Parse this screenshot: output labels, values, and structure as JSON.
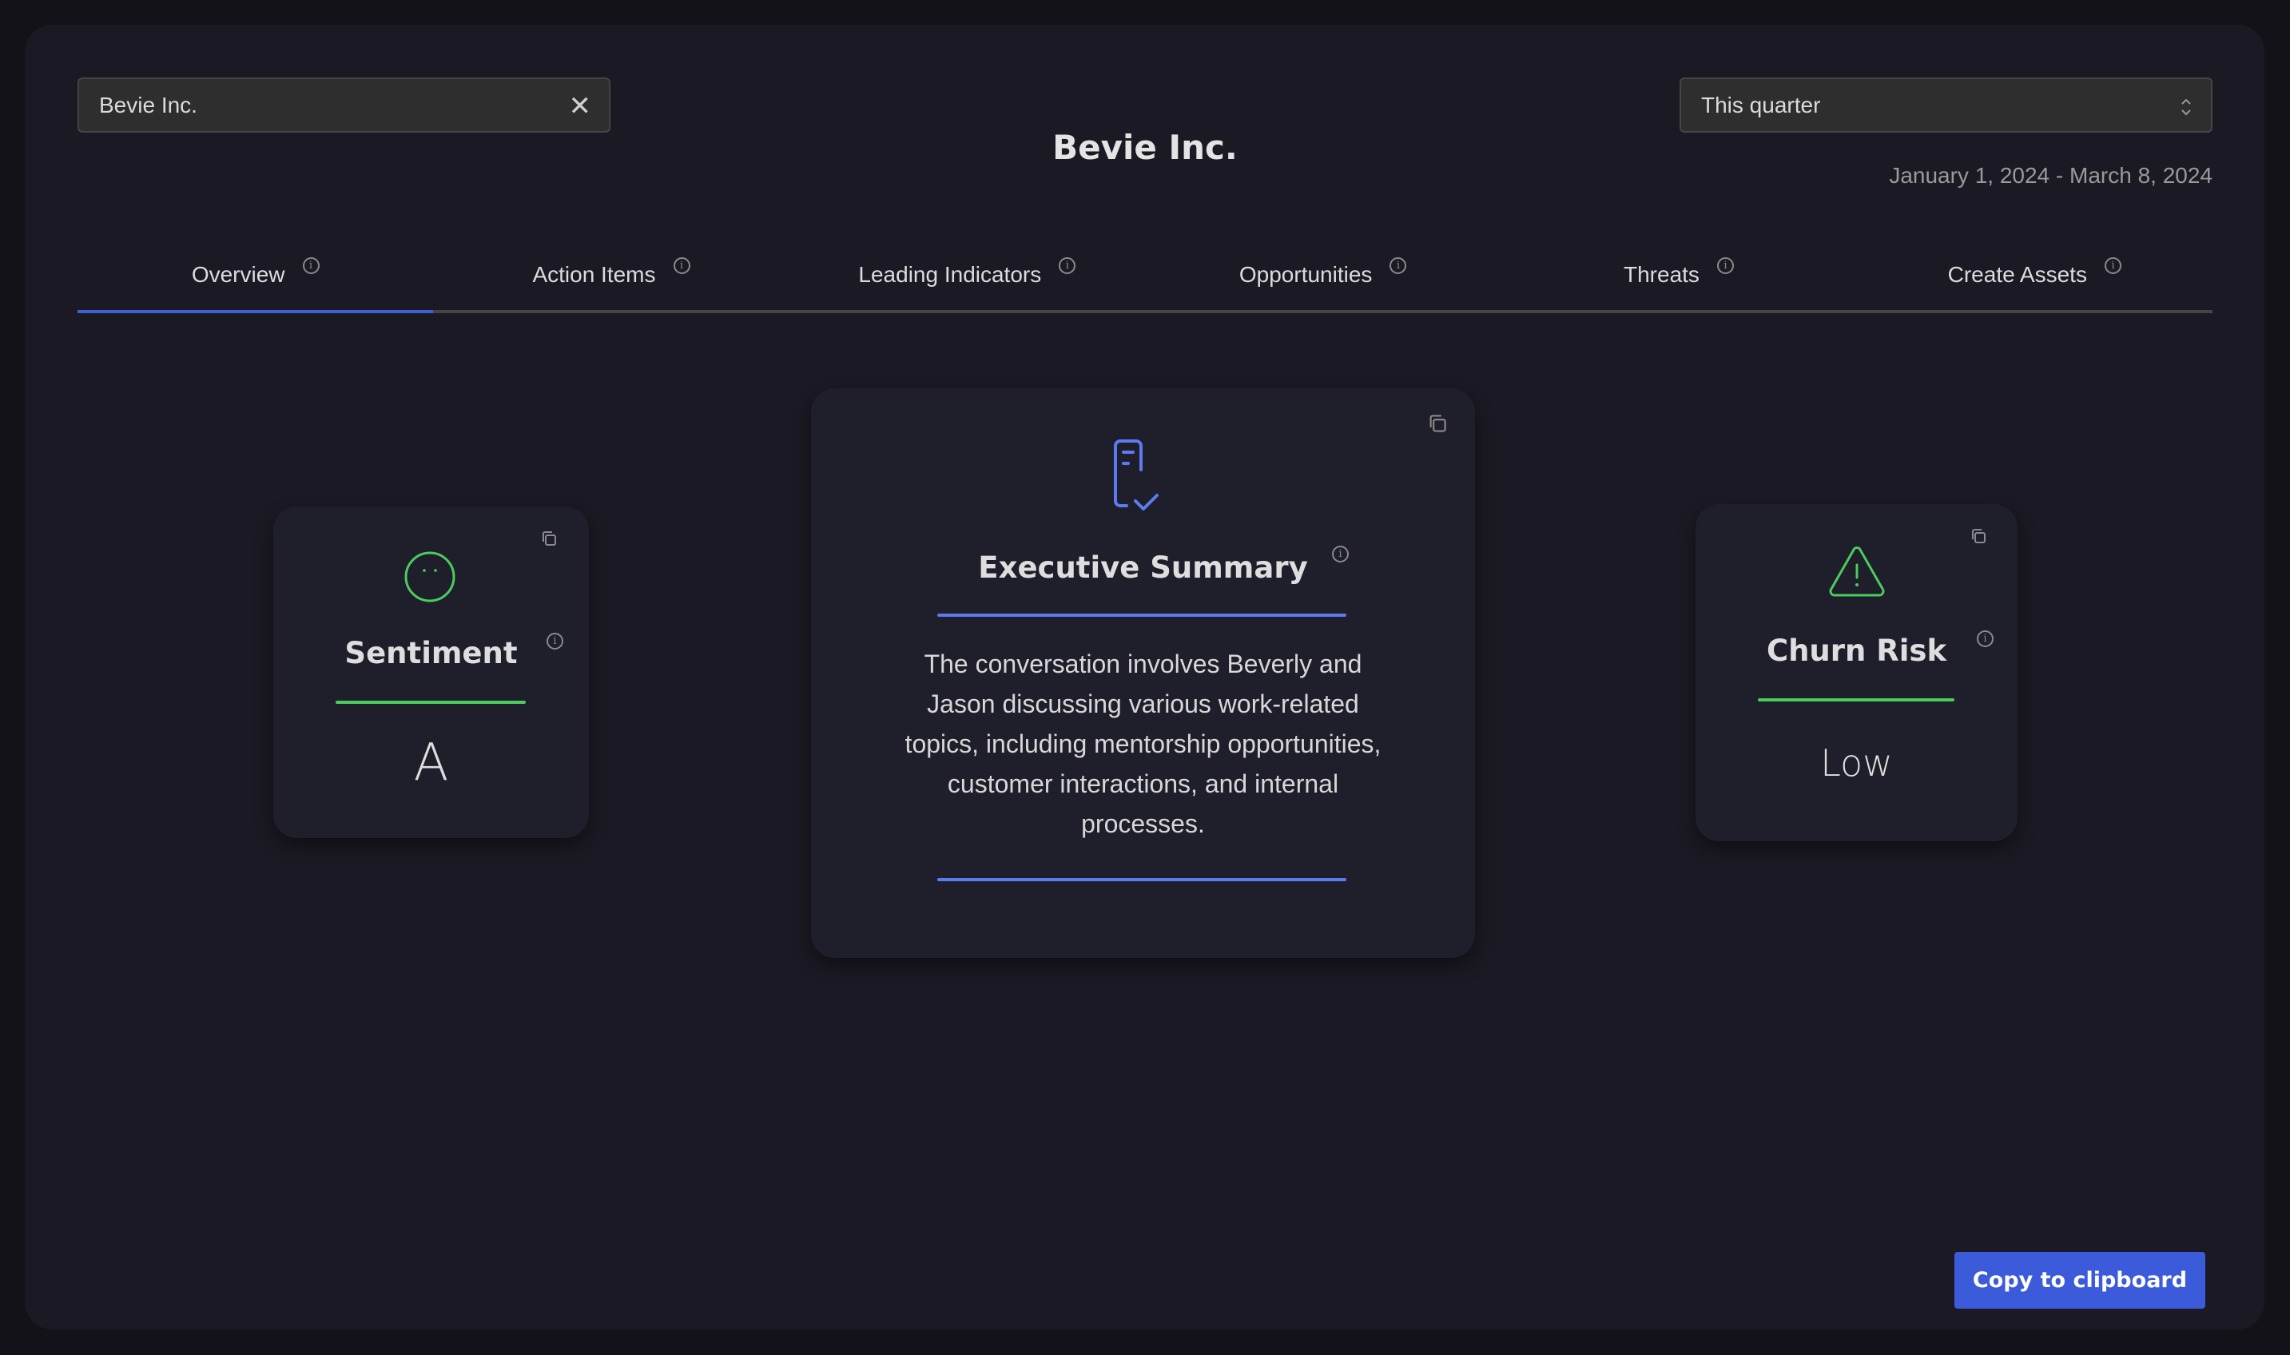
{
  "search": {
    "value": "Bevie Inc.",
    "clear_icon": "close-icon"
  },
  "header": {
    "title": "Bevie Inc."
  },
  "period": {
    "selected": "This quarter",
    "date_range": "January 1, 2024 - March 8, 2024"
  },
  "tabs": [
    {
      "label": "Overview",
      "active": true
    },
    {
      "label": "Action Items"
    },
    {
      "label": "Leading Indicators"
    },
    {
      "label": "Opportunities"
    },
    {
      "label": "Threats"
    },
    {
      "label": "Create Assets"
    }
  ],
  "cards": {
    "sentiment": {
      "title": "Sentiment",
      "value": "A",
      "icon": "neutral-face-icon",
      "accent": "#4ccc5c"
    },
    "summary": {
      "title": "Executive Summary",
      "text": "The conversation involves Beverly and Jason discussing various work-related topics, including mentorship opportunities, customer interactions, and internal processes.",
      "icon": "document-check-icon",
      "accent": "#5b7cf0"
    },
    "churn": {
      "title": "Churn Risk",
      "value": "Low",
      "icon": "warning-triangle-icon",
      "accent": "#4ccc5c"
    }
  },
  "footer": {
    "copy_label": "Copy to clipboard"
  },
  "colors": {
    "primary": "#3b5bdb",
    "background": "#1b1a24",
    "card": "#1f1e2b"
  }
}
